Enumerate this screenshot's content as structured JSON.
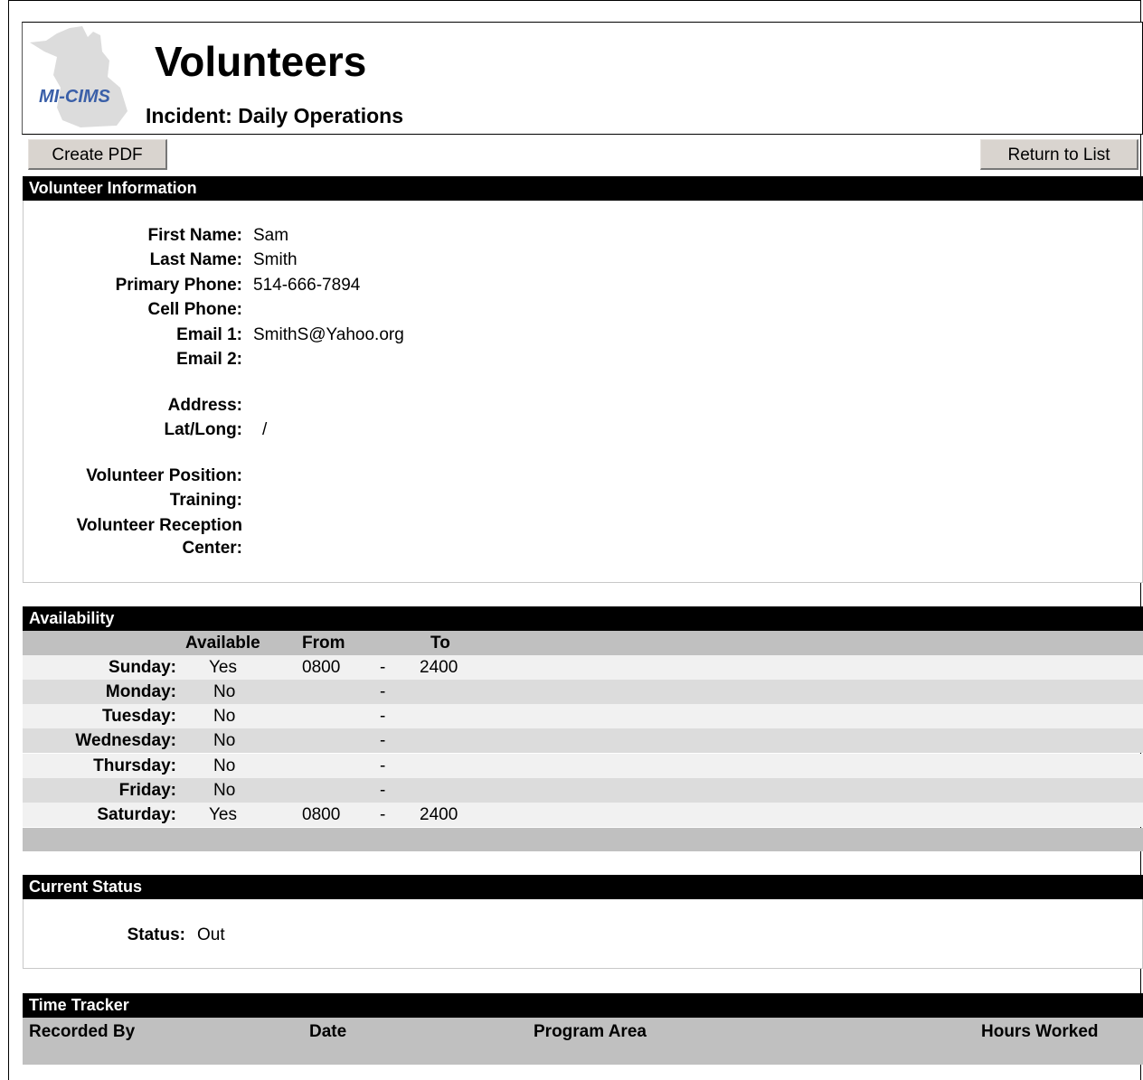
{
  "header": {
    "title": "Volunteers",
    "incident": "Incident: Daily Operations",
    "logo_text": "MI-CIMS"
  },
  "toolbar": {
    "create_pdf": "Create PDF",
    "return_to_list": "Return to List"
  },
  "volunteer_info": {
    "heading": "Volunteer Information",
    "fields": [
      {
        "label": "First Name:",
        "value": "Sam"
      },
      {
        "label": "Last Name:",
        "value": "Smith"
      },
      {
        "label": "Primary Phone:",
        "value": "514-666-7894"
      },
      {
        "label": "Cell Phone:",
        "value": ""
      },
      {
        "label": "Email 1:",
        "value": "SmithS@Yahoo.org"
      },
      {
        "label": "Email 2:",
        "value": ""
      },
      {
        "label": "Address:",
        "value": ""
      },
      {
        "label": "Lat/Long:",
        "value": "/"
      },
      {
        "label": "Volunteer Position:",
        "value": ""
      },
      {
        "label": "Training:",
        "value": ""
      },
      {
        "label": "Volunteer Reception",
        "value": ""
      },
      {
        "label": "Center:",
        "value": ""
      }
    ]
  },
  "availability": {
    "heading": "Availability",
    "columns": {
      "available": "Available",
      "from": "From",
      "to": "To"
    },
    "rows": [
      {
        "day": "Sunday:",
        "available": "Yes",
        "from": "0800",
        "dash": "-",
        "to": "2400"
      },
      {
        "day": "Monday:",
        "available": "No",
        "from": "",
        "dash": "-",
        "to": ""
      },
      {
        "day": "Tuesday:",
        "available": "No",
        "from": "",
        "dash": "-",
        "to": ""
      },
      {
        "day": "Wednesday:",
        "available": "No",
        "from": "",
        "dash": "-",
        "to": ""
      },
      {
        "day": "Thursday:",
        "available": "No",
        "from": "",
        "dash": "-",
        "to": ""
      },
      {
        "day": "Friday:",
        "available": "No",
        "from": "",
        "dash": "-",
        "to": ""
      },
      {
        "day": "Saturday:",
        "available": "Yes",
        "from": "0800",
        "dash": "-",
        "to": "2400"
      }
    ]
  },
  "current_status": {
    "heading": "Current Status",
    "label": "Status:",
    "value": "Out"
  },
  "time_tracker": {
    "heading": "Time Tracker",
    "columns": {
      "recorded_by": "Recorded By",
      "date": "Date",
      "program_area": "Program Area",
      "hours_worked": "Hours Worked"
    }
  },
  "colors": {
    "section_header_bg": "#000000",
    "table_header_bg": "#c0c0c0",
    "row_odd": "#f1f1f1",
    "row_even": "#dcdcdc",
    "logo_text": "#3a5fa8"
  }
}
